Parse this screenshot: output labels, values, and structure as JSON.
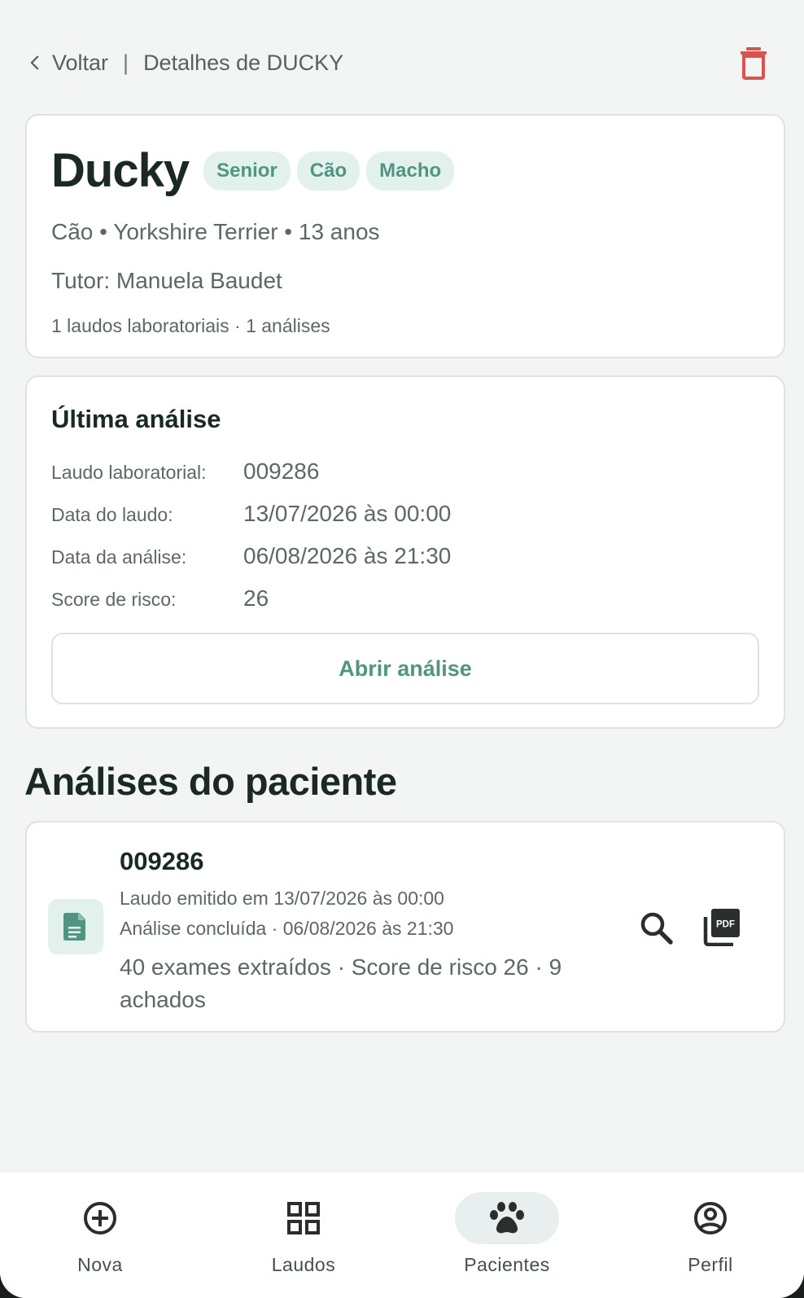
{
  "header": {
    "back_label": "Voltar",
    "separator": "|",
    "breadcrumb": "Detalhes de DUCKY"
  },
  "patient": {
    "name": "Ducky",
    "tags": [
      "Senior",
      "Cão",
      "Macho"
    ],
    "subtitle": "Cão • Yorkshire Terrier • 13 anos",
    "tutor": "Tutor: Manuela Baudet",
    "counts": "1 laudos laboratoriais · 1 análises"
  },
  "last_analysis": {
    "title": "Última análise",
    "rows": [
      {
        "label": "Laudo laboratorial:",
        "value": "009286"
      },
      {
        "label": "Data do laudo:",
        "value": "13/07/2026 às 00:00"
      },
      {
        "label": "Data da análise:",
        "value": "06/08/2026 às 21:30"
      },
      {
        "label": "Score de risco:",
        "value": "26"
      }
    ],
    "open_button": "Abrir análise"
  },
  "analyses": {
    "section_title": "Análises do paciente",
    "items": [
      {
        "title": "009286",
        "issued": "Laudo emitido em 13/07/2026 às 00:00",
        "completed": "Análise concluída · 06/08/2026 às 21:30",
        "summary": "40 exames extraídos · Score de risco 26 · 9 achados",
        "icons": [
          "document-icon",
          "search-icon",
          "pdf-icon"
        ]
      }
    ]
  },
  "bottom_nav": {
    "items": [
      {
        "label": "Nova",
        "icon": "add-circle-icon",
        "active": false
      },
      {
        "label": "Laudos",
        "icon": "grid-icon",
        "active": false
      },
      {
        "label": "Pacientes",
        "icon": "paw-icon",
        "active": true
      },
      {
        "label": "Perfil",
        "icon": "account-circle-icon",
        "active": false
      }
    ]
  },
  "colors": {
    "accent": "#4f9582",
    "tag_bg": "#e3f1ed",
    "danger": "#d9534f",
    "background": "#f3f5f5"
  }
}
